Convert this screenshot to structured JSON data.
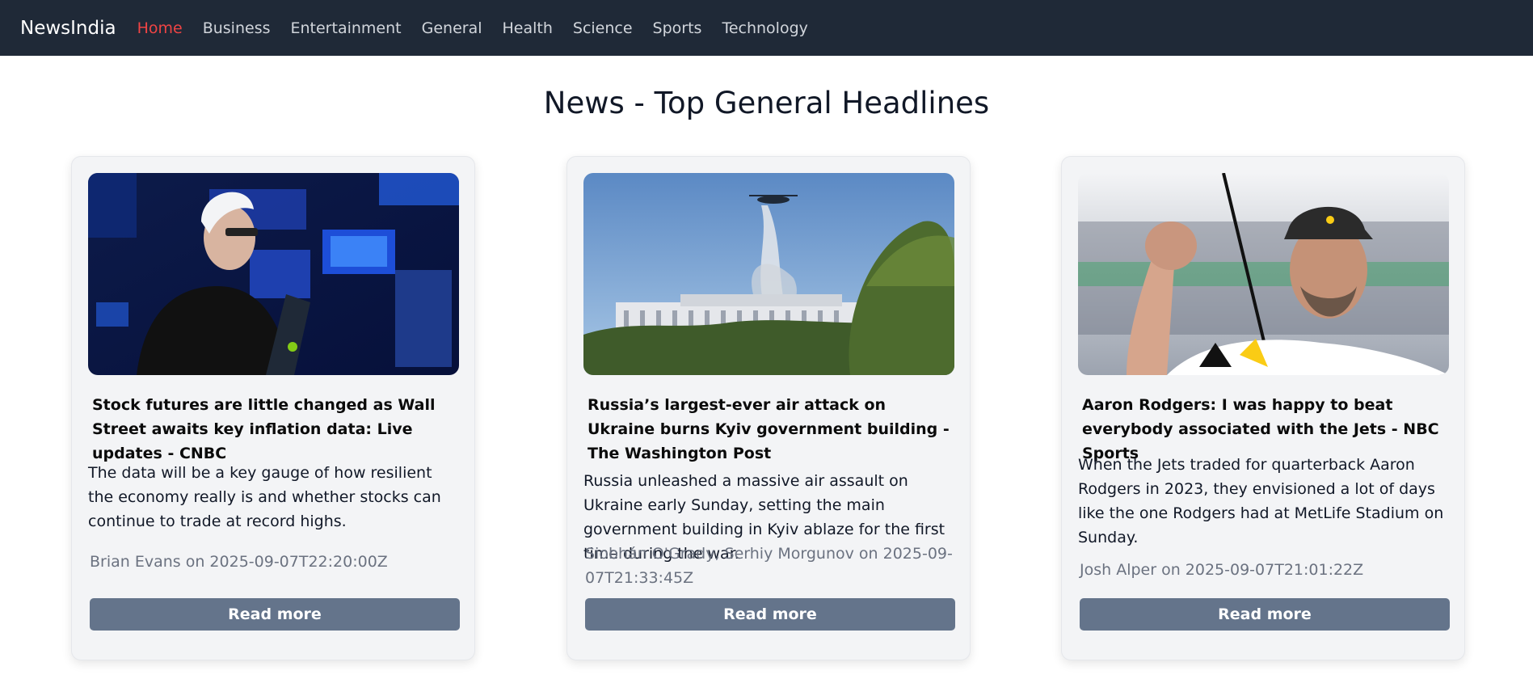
{
  "nav": {
    "brand": "NewsIndia",
    "links": [
      {
        "label": "Home",
        "active": true
      },
      {
        "label": "Business"
      },
      {
        "label": "Entertainment"
      },
      {
        "label": "General"
      },
      {
        "label": "Health"
      },
      {
        "label": "Science"
      },
      {
        "label": "Sports"
      },
      {
        "label": "Technology"
      }
    ]
  },
  "page": {
    "title": "News - Top General Headlines"
  },
  "articles": [
    {
      "title": "Stock futures are little changed as Wall Street awaits key inflation data: Live updates - CNBC",
      "description": "The data will be a key gauge of how resilient the economy really is and whether stocks can continue to trade at record highs.",
      "meta": "Brian Evans on 2025-09-07T22:20:00Z",
      "button": "Read more"
    },
    {
      "title": "Russia’s largest-ever air attack on Ukraine burns Kyiv government building - The Washington Post",
      "description": "Russia unleashed a massive air assault on Ukraine early Sunday, setting the main government building in Kyiv ablaze for the first time during the war.",
      "meta": "Siobhán O'Grady, Serhiy Morgunov on 2025-09-07T21:33:45Z",
      "button": "Read more"
    },
    {
      "title": "Aaron Rodgers: I was happy to beat everybody associated with the Jets - NBC Sports",
      "description": "When the Jets traded for quarterback Aaron Rodgers in 2023, they envisioned a lot of days like the one Rodgers had at MetLife Stadium on Sunday.",
      "meta": "Josh Alper on 2025-09-07T21:01:22Z",
      "button": "Read more"
    }
  ],
  "colors": {
    "navbar_bg": "#1f2937",
    "nav_active": "#ef4444",
    "button_bg": "#64748b",
    "card_bg": "#f3f4f6"
  }
}
